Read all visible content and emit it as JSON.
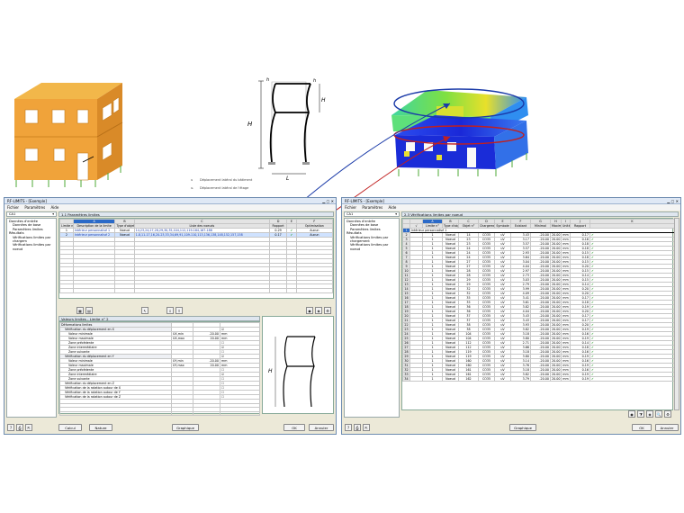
{
  "diagram": {
    "h": "h",
    "hi": "H",
    "hi_small": "h",
    "H": "H",
    "Hi": "H",
    "i": "i",
    "L": "L",
    "legend": [
      {
        "sym": "u",
        "text": "Déplacement latéral du bâtiment"
      },
      {
        "sym": "uᵢ",
        "text": "Déplacement latéral de l'étage"
      }
    ]
  },
  "left": {
    "title": "RF-LIMITS - [Exemple]",
    "menu": [
      "Fichier",
      "Paramètres",
      "Aide"
    ],
    "case": "CA1",
    "panel_title": "1.1 Paramètres limites",
    "nav": [
      {
        "t": "Données d'entrée",
        "lvl": 0
      },
      {
        "t": "Données de base",
        "lvl": 1
      },
      {
        "t": "Paramètres limites",
        "lvl": 1
      },
      {
        "t": "Résultats",
        "lvl": 0
      },
      {
        "t": "Vérifications limites par chargem",
        "lvl": 1
      },
      {
        "t": "Vérifications limites par noeud",
        "lvl": 1
      }
    ],
    "colletters": [
      "A",
      "B",
      "C",
      "D",
      "E",
      "F"
    ],
    "headers": [
      "Limite n°",
      "Description de la limite",
      "Type d'objet",
      "Liste des noeuds",
      "Rapport",
      "Optimisation"
    ],
    "header_group": "Type",
    "rows": [
      {
        "n": "1",
        "desc": "Intérieur personnalisé 1",
        "type": "Noeud",
        "list": "14,23,24,27,28,29,30,35,104,112,119-164,167-188",
        "ratio": "0.29",
        "opt": "Aucun"
      },
      {
        "n": "2",
        "desc": "Intérieur personnalisé 2",
        "type": "Noeud",
        "list": "1-8,11-17,16,20-23,33,34,69,91,109-110,113,136,138,148,152,157,158",
        "ratio": "0.17",
        "opt": "Aucun"
      }
    ],
    "params_title": "Valeurs limites - Limite n° 2",
    "params": [
      {
        "k": "Déformations limites",
        "u": "",
        "v": "",
        "c": "",
        "lvl": 0,
        "grp": true
      },
      {
        "k": "Vérification du déplacement en X",
        "u": "",
        "v": "",
        "c": "☑",
        "lvl": 1,
        "grp": true
      },
      {
        "k": "Valeur minimale",
        "u": "UX,min",
        "v": "-20.00",
        "c": "mm",
        "lvl": 2
      },
      {
        "k": "Valeur maximale",
        "u": "UX,max",
        "v": "20.00",
        "c": "mm",
        "lvl": 2
      },
      {
        "k": "Zone précédente",
        "u": "",
        "v": "",
        "c": "☐",
        "lvl": 2
      },
      {
        "k": "Zone intermédiaire",
        "u": "",
        "v": "",
        "c": "☑",
        "lvl": 2
      },
      {
        "k": "Zone suivante",
        "u": "",
        "v": "",
        "c": "☐",
        "lvl": 2
      },
      {
        "k": "Vérification du déplacement en Y",
        "u": "",
        "v": "",
        "c": "☑",
        "lvl": 1,
        "grp": true
      },
      {
        "k": "Valeur minimale",
        "u": "UY,min",
        "v": "-20.00",
        "c": "mm",
        "lvl": 2
      },
      {
        "k": "Valeur maximale",
        "u": "UY,max",
        "v": "20.00",
        "c": "mm",
        "lvl": 2
      },
      {
        "k": "Zone précédente",
        "u": "",
        "v": "",
        "c": "☐",
        "lvl": 2
      },
      {
        "k": "Zone intermédiaire",
        "u": "",
        "v": "",
        "c": "☑",
        "lvl": 2
      },
      {
        "k": "Zone suivante",
        "u": "",
        "v": "",
        "c": "☐",
        "lvl": 2
      },
      {
        "k": "Vérification du déplacement en Z",
        "u": "",
        "v": "",
        "c": "☐",
        "lvl": 1
      },
      {
        "k": "Vérification de la rotation autour de X",
        "u": "",
        "v": "",
        "c": "☐",
        "lvl": 1
      },
      {
        "k": "Vérification de la rotation autour de Y",
        "u": "",
        "v": "",
        "c": "☐",
        "lvl": 1
      },
      {
        "k": "Vérification de la rotation autour de Z",
        "u": "",
        "v": "",
        "c": "☐",
        "lvl": 1
      }
    ],
    "buttons": {
      "calc": "Calcul",
      "nature": "Nature",
      "graph": "Graphique",
      "ok": "OK",
      "cancel": "Annuler"
    }
  },
  "right": {
    "title": "RF-LIMITS - [Exemple]",
    "menu": [
      "Fichier",
      "Paramètres",
      "Aide"
    ],
    "case": "CA1",
    "panel_title": "2.3 Vérifications limites par noeud",
    "nav": [
      {
        "t": "Données d'entrée",
        "lvl": 0
      },
      {
        "t": "Données de base",
        "lvl": 1
      },
      {
        "t": "Paramètres limites",
        "lvl": 1
      },
      {
        "t": "Résultats",
        "lvl": 0
      },
      {
        "t": "Vérifications limites par chargement",
        "lvl": 1
      },
      {
        "t": "Vérifications limites par noeud",
        "lvl": 1
      }
    ],
    "colletters": [
      "A",
      "B",
      "C",
      "D",
      "E",
      "F",
      "G",
      "H",
      "I",
      "J",
      "K",
      "L"
    ],
    "headers": [
      "Limite n°",
      "Type d'objet",
      "Objet n°",
      "Chargement n°",
      "Symbole",
      "Existant",
      "Minimal",
      "Maximal",
      "Unité",
      "Rapport"
    ],
    "header_group": "Valeur",
    "group_row": "Intérieur personnalisé 1",
    "rows": [
      [
        "2",
        "1",
        "Noeud",
        "14",
        "CO35",
        "uV",
        "3.43",
        "-20.00",
        "20.00",
        "mm",
        "0.17"
      ],
      [
        "3",
        "1",
        "Noeud",
        "23",
        "CO35",
        "uV",
        "3.17",
        "-20.00",
        "20.00",
        "mm",
        "0.16"
      ],
      [
        "4",
        "1",
        "Noeud",
        "23",
        "CO35",
        "uV",
        "3.57",
        "-20.00",
        "20.00",
        "mm",
        "0.18"
      ],
      [
        "5",
        "1",
        "Noeud",
        "24",
        "CO35",
        "uV",
        "3.57",
        "-20.00",
        "20.00",
        "mm",
        "0.18"
      ],
      [
        "6",
        "1",
        "Noeud",
        "24",
        "CO35",
        "uV",
        "2.93",
        "-20.00",
        "20.00",
        "mm",
        "0.15"
      ],
      [
        "7",
        "1",
        "Noeud",
        "24",
        "CO35",
        "uV",
        "3.64",
        "-20.00",
        "20.00",
        "mm",
        "0.18"
      ],
      [
        "8",
        "1",
        "Noeud",
        "27",
        "CO35",
        "uV",
        "3.04",
        "-20.00",
        "20.00",
        "mm",
        "0.15"
      ],
      [
        "9",
        "1",
        "Noeud",
        "27",
        "CO35",
        "uV",
        "4.04",
        "-20.00",
        "20.00",
        "mm",
        "0.20"
      ],
      [
        "10",
        "1",
        "Noeud",
        "28",
        "CO35",
        "uV",
        "2.97",
        "-20.00",
        "20.00",
        "mm",
        "0.15"
      ],
      [
        "11",
        "1",
        "Noeud",
        "28",
        "CO35",
        "uV",
        "2.73",
        "-20.00",
        "20.00",
        "mm",
        "0.14"
      ],
      [
        "12",
        "1",
        "Noeud",
        "29",
        "CO35",
        "uV",
        "3.03",
        "-20.00",
        "20.00",
        "mm",
        "0.15"
      ],
      [
        "13",
        "1",
        "Noeud",
        "29",
        "CO35",
        "uV",
        "2.79",
        "-20.00",
        "20.00",
        "mm",
        "0.14"
      ],
      [
        "14",
        "1",
        "Noeud",
        "32",
        "CO35",
        "uV",
        "3.99",
        "-20.00",
        "20.00",
        "mm",
        "0.20"
      ],
      [
        "15",
        "1",
        "Noeud",
        "32",
        "CO35",
        "uV",
        "4.09",
        "-20.00",
        "20.00",
        "mm",
        "0.20"
      ],
      [
        "16",
        "1",
        "Noeud",
        "35",
        "CO35",
        "uV",
        "3.41",
        "-20.00",
        "20.00",
        "mm",
        "0.17"
      ],
      [
        "17",
        "1",
        "Noeud",
        "35",
        "CO35",
        "uV",
        "3.61",
        "-20.00",
        "20.00",
        "mm",
        "0.18"
      ],
      [
        "18",
        "1",
        "Noeud",
        "36",
        "CO35",
        "uV",
        "3.82",
        "-20.00",
        "20.00",
        "mm",
        "0.19"
      ],
      [
        "19",
        "1",
        "Noeud",
        "36",
        "CO35",
        "uV",
        "4.04",
        "-20.00",
        "20.00",
        "mm",
        "0.20"
      ],
      [
        "20",
        "1",
        "Noeud",
        "37",
        "CO35",
        "uV",
        "3.43",
        "-20.00",
        "20.00",
        "mm",
        "0.17"
      ],
      [
        "21",
        "1",
        "Noeud",
        "37",
        "CO35",
        "uV",
        "3.43",
        "-20.00",
        "20.00",
        "mm",
        "0.17"
      ],
      [
        "22",
        "1",
        "Noeud",
        "38",
        "CO35",
        "uV",
        "3.93",
        "-20.00",
        "20.00",
        "mm",
        "0.20"
      ],
      [
        "23",
        "1",
        "Noeud",
        "38",
        "CO35",
        "uV",
        "3.82",
        "-20.00",
        "20.00",
        "mm",
        "0.19"
      ],
      [
        "24",
        "1",
        "Noeud",
        "104",
        "CO35",
        "uV",
        "3.18",
        "-20.00",
        "20.00",
        "mm",
        "0.16"
      ],
      [
        "25",
        "1",
        "Noeud",
        "104",
        "CO35",
        "uV",
        "3.80",
        "-20.00",
        "20.00",
        "mm",
        "0.19"
      ],
      [
        "26",
        "1",
        "Noeud",
        "112",
        "CO35",
        "uV",
        "2.71",
        "-20.00",
        "20.00",
        "mm",
        "0.14"
      ],
      [
        "27",
        "1",
        "Noeud",
        "112",
        "CO35",
        "uV",
        "3.66",
        "-20.00",
        "20.00",
        "mm",
        "0.18"
      ],
      [
        "28",
        "1",
        "Noeud",
        "119",
        "CO35",
        "uV",
        "3.18",
        "-20.00",
        "20.00",
        "mm",
        "0.16"
      ],
      [
        "29",
        "1",
        "Noeud",
        "119",
        "CO35",
        "uV",
        "3.80",
        "-20.00",
        "20.00",
        "mm",
        "0.19"
      ],
      [
        "30",
        "1",
        "Noeud",
        "160",
        "CO35",
        "uV",
        "3.14",
        "-20.00",
        "20.00",
        "mm",
        "0.16"
      ],
      [
        "31",
        "1",
        "Noeud",
        "160",
        "CO35",
        "uV",
        "3.76",
        "-20.00",
        "20.00",
        "mm",
        "0.19"
      ],
      [
        "32",
        "1",
        "Noeud",
        "161",
        "CO35",
        "uV",
        "3.18",
        "-20.00",
        "20.00",
        "mm",
        "0.16"
      ],
      [
        "33",
        "1",
        "Noeud",
        "161",
        "CO35",
        "uV",
        "3.82",
        "-20.00",
        "20.00",
        "mm",
        "0.19"
      ],
      [
        "34",
        "1",
        "Noeud",
        "162",
        "CO35",
        "uV",
        "3.79",
        "-20.00",
        "20.00",
        "mm",
        "0.19"
      ]
    ],
    "buttons": {
      "graph": "Graphique",
      "ok": "OK",
      "cancel": "Annuler"
    }
  }
}
